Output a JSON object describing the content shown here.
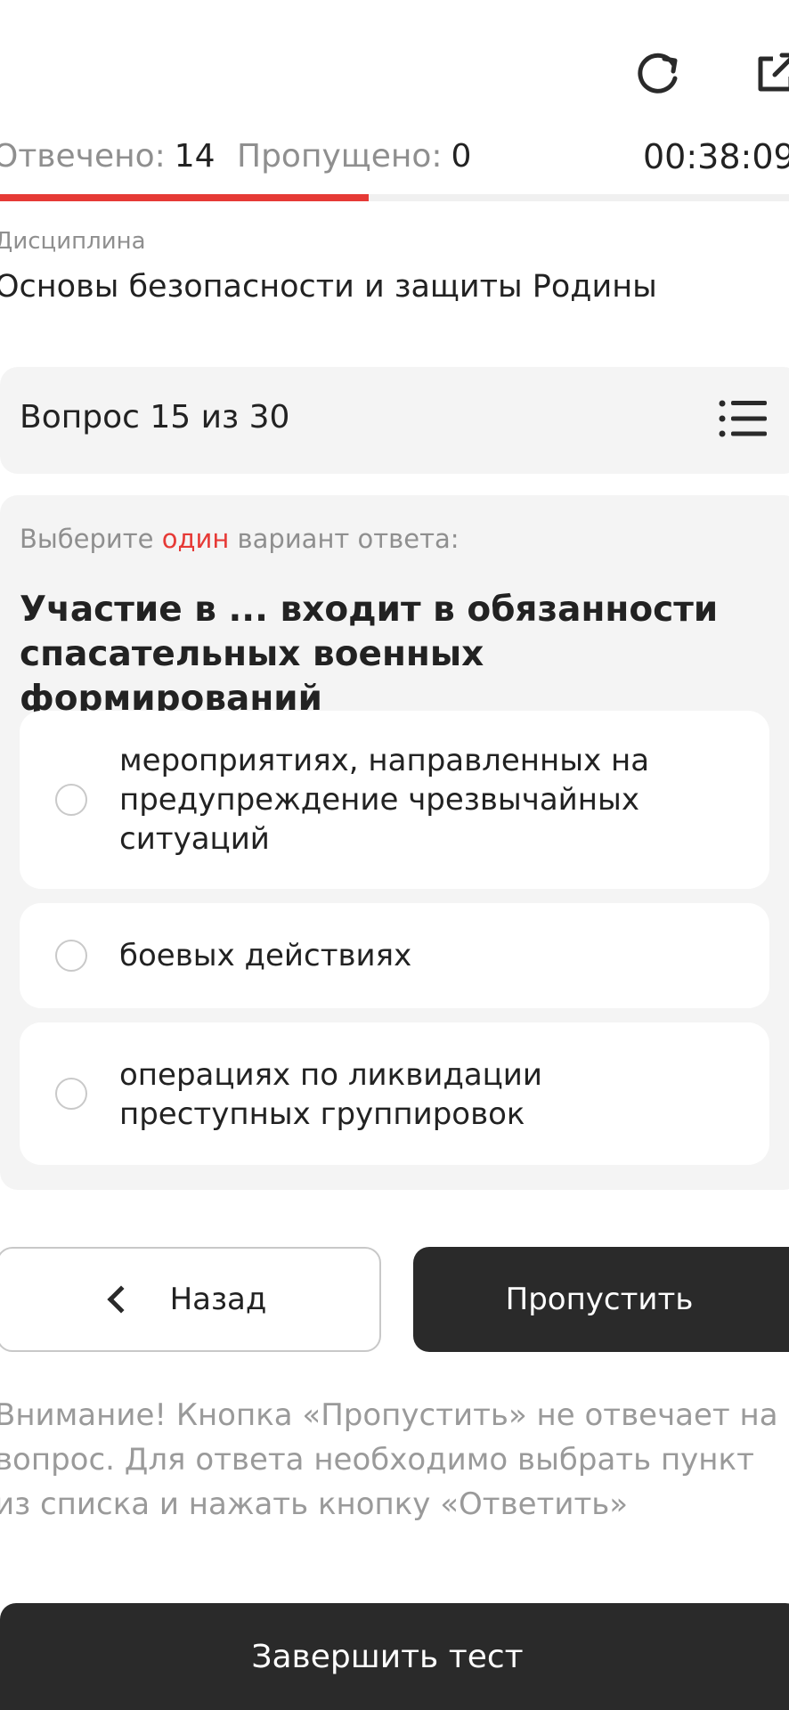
{
  "header": {
    "icons": [
      "chevron-left-icon",
      "reload-icon",
      "share-icon"
    ]
  },
  "stats": {
    "answered_label": "Отвечено:",
    "answered_value": "14",
    "skipped_label": "Пропущено:",
    "skipped_value": "0",
    "timer": "00:38:09"
  },
  "progress": {
    "fraction": 0.467
  },
  "colors": {
    "accent": "#e63a36",
    "dark_button": "#2a2a2a",
    "card_bg": "#f4f4f4"
  },
  "discipline": {
    "label": "Дисциплина",
    "title": "Основы безопасности и защиты Родины"
  },
  "question": {
    "counter": "Вопрос 15 из 30",
    "instruction_prefix": "Выберите ",
    "instruction_accent": "один",
    "instruction_suffix": " вариант ответа:",
    "text": "Участие в ... входит в обязанности спасательных военных формирований",
    "options": [
      {
        "label": "мероприятиях, направленных на предупреждение чрезвычайных ситуаций",
        "selected": false
      },
      {
        "label": "боевых действиях",
        "selected": false
      },
      {
        "label": "операциях по ликвидации преступных группировок",
        "selected": false
      }
    ]
  },
  "buttons": {
    "back": "Назад",
    "skip": "Пропустить",
    "finish": "Завершить тест"
  },
  "notice": "Внимание! Кнопка «Пропустить» не отвечает на вопрос. Для ответа необходимо выбрать пункт из списка и нажать кнопку «Ответить»"
}
